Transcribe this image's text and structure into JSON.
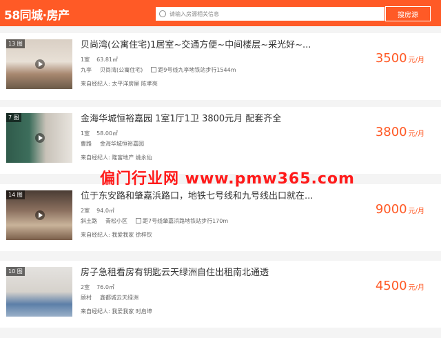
{
  "header": {
    "logo_num": "58",
    "logo_text": "同城·房产",
    "search_placeholder": "请输入房源相关信息",
    "search_button": "搜房源"
  },
  "listings": [
    {
      "photo_count": "13 图",
      "title": "贝尚湾(公寓住宅)1居室~交通方便~中间楼层~采光好~...",
      "rooms": "1室",
      "size": "63.81㎡",
      "district": "九亭",
      "community": "贝尚湾(公寓住宅)",
      "subway": "距9号线九亭地铁站步行1544m",
      "agent": "来自经纪人: 太平洋房屋 陈孝亮",
      "price": "3500",
      "price_unit": "元/月"
    },
    {
      "photo_count": "7 图",
      "title": "金海华城恒裕嘉园 1室1厅1卫 3800元月 配套齐全",
      "rooms": "1室",
      "size": "58.00㎡",
      "district": "曹路",
      "community": "金海华城恒裕嘉园",
      "subway": "",
      "agent": "来自经纪人: 隆富地产 姚永仙",
      "price": "3800",
      "price_unit": "元/月"
    },
    {
      "photo_count": "14 图",
      "title": "位于东安路和肇嘉浜路口，地铁七号线和九号线出口就在...",
      "rooms": "2室",
      "size": "94.0㎡",
      "district": "斜土路",
      "community": "青松小区",
      "subway": "距7号线肇嘉浜路地铁站步行170m",
      "agent": "来自经纪人: 我爱我家 徐梓钦",
      "price": "9000",
      "price_unit": "元/月"
    },
    {
      "photo_count": "10 图",
      "title": "房子急租看房有钥匙云天绿洲自住出租南北通透",
      "rooms": "2室",
      "size": "76.0㎡",
      "district": "顾村",
      "community": "鑫都城云天绿洲",
      "subway": "",
      "agent": "来自经纪人: 我爱我家 时启坤",
      "price": "4500",
      "price_unit": "元/月"
    }
  ],
  "watermark": "偏门行业网 www.pmw365.com",
  "colors": {
    "brand": "#ff5a26",
    "watermark": "#ff1a1a"
  },
  "icons": [
    "play-icon",
    "subway-icon",
    "radio-icon"
  ]
}
